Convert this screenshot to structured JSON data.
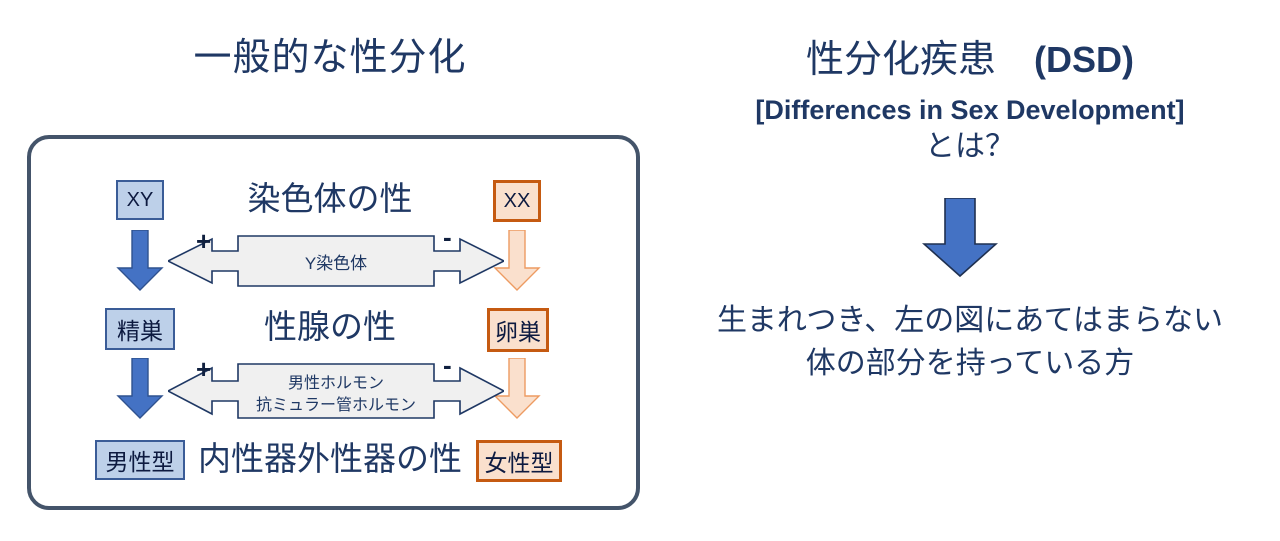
{
  "page": {
    "background": "#ffffff",
    "accent_navy": "#1f3864",
    "accent_blue": "#4472c4",
    "accent_blue_light": "#bdd0e9",
    "accent_orange": "#c55a11",
    "accent_orange_light": "#fae0cd",
    "frame_border": "#44546a"
  },
  "left_panel": {
    "title": "一般的な性分化",
    "rows": [
      {
        "left_box": "XY",
        "center_label": "染色体の性",
        "right_box": "XX"
      },
      {
        "left_box": "精巣",
        "center_label": "性腺の性",
        "right_box": "卵巣"
      },
      {
        "left_box": "男性型",
        "center_label": "内性器外性器の性",
        "right_box": "女性型"
      }
    ],
    "banners": [
      {
        "line1": "Y染色体",
        "line2": "",
        "plus": "+",
        "minus": "-"
      },
      {
        "line1": "男性ホルモン",
        "line2": "抗ミュラー管ホルモン",
        "plus": "+",
        "minus": "-"
      }
    ]
  },
  "right_panel": {
    "title_ja": "性分化疾患　",
    "title_abbr": "(DSD)",
    "title_sub": "[Differences in Sex Development]",
    "title_question": "とは？",
    "arrow_icon": "down-arrow-icon",
    "body_line1": "生まれつき、左の図にあてはまらない",
    "body_line2": "体の部分を持っている方"
  }
}
